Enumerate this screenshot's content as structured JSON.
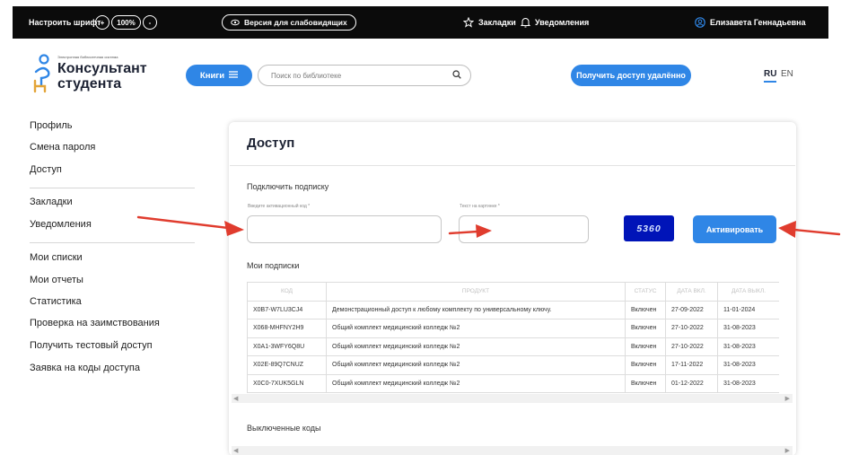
{
  "topbar": {
    "font_label": "Настроить шрифт",
    "font_increase": "+",
    "font_zoom": "100%",
    "font_decrease": "-",
    "visually_impaired": "Версия для слабовидящих",
    "bookmarks": "Закладки",
    "notifications": "Уведомления",
    "user_name": "Елизавета Геннадьевна"
  },
  "header": {
    "logo_subtitle": "Электронная библиотечная система",
    "logo_line1": "Консультант",
    "logo_line2": "студента",
    "books_button": "Книги",
    "search_placeholder": "Поиск по библиотеке",
    "remote_access_button": "Получить доступ удалённо",
    "lang_ru": "RU",
    "lang_en": "EN"
  },
  "sidebar": {
    "items": [
      "Профиль",
      "Смена пароля",
      "Доступ",
      "Закладки",
      "Уведомления",
      "Мои списки",
      "Мои отчеты",
      "Статистика",
      "Проверка на заимствования",
      "Получить тестовый доступ",
      "Заявка на коды доступа"
    ]
  },
  "main": {
    "title": "Доступ",
    "subscribe_heading": "Подключить подписку",
    "activation_code_label": "Введите активационный код *",
    "captcha_text_label": "Текст на картинке *",
    "captcha_value": "5360",
    "activate_button": "Активировать",
    "my_subscriptions_heading": "Мои подписки",
    "disabled_codes_heading": "Выключенные коды",
    "table": {
      "headers": [
        "КОД",
        "ПРОДУКТ",
        "СТАТУС",
        "ДАТА ВКЛ.",
        "ДАТА ВЫКЛ."
      ],
      "rows": [
        [
          "X0B7-W7LU3CJ4",
          "Демонстрационный доступ к любому комплекту по универсальному ключу.",
          "Включен",
          "27-09-2022",
          "11-01-2024"
        ],
        [
          "X068-MHFNY2H9",
          "Общий комплект медицинский колледж №2",
          "Включен",
          "27-10-2022",
          "31-08-2023"
        ],
        [
          "X0A1-3WFY6Q8U",
          "Общий комплект медицинский колледж №2",
          "Включен",
          "27-10-2022",
          "31-08-2023"
        ],
        [
          "X02E-89Q7CNUZ",
          "Общий комплект медицинский колледж №2",
          "Включен",
          "17-11-2022",
          "31-08-2023"
        ],
        [
          "X0C0-7XUK5GLN",
          "Общий комплект медицинский колледж №2",
          "Включен",
          "01-12-2022",
          "31-08-2023"
        ]
      ]
    }
  },
  "colors": {
    "accent": "#2f86e6",
    "topbar": "#0b0b0b",
    "captcha_bg": "#0014b8",
    "arrow": "#e03c2e"
  }
}
